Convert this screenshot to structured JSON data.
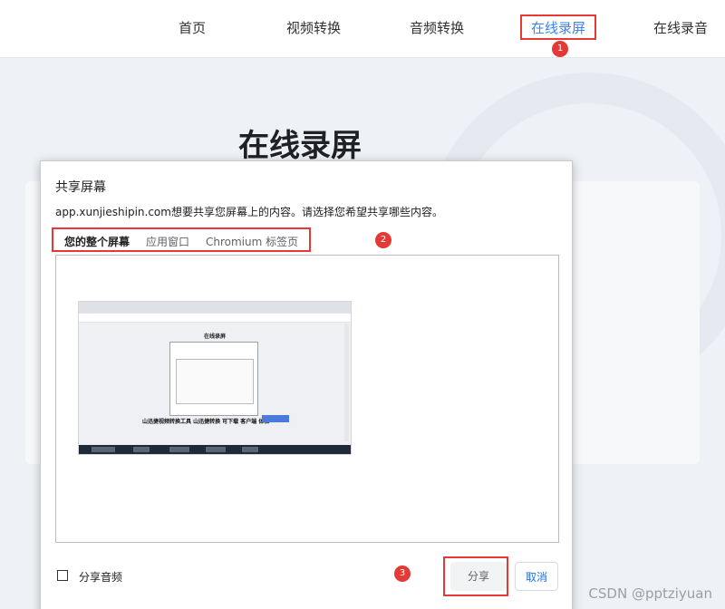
{
  "nav": {
    "items": [
      {
        "label": "首页"
      },
      {
        "label": "视频转换"
      },
      {
        "label": "音频转换"
      },
      {
        "label": "在线录屏",
        "active": true
      },
      {
        "label": "在线录音"
      }
    ]
  },
  "hero": {
    "title": "在线录屏"
  },
  "dialog": {
    "title": "共享屏幕",
    "description": "app.xunjieshipin.com想要共享您屏幕上的内容。请选择您希望共享哪些内容。",
    "tabs": [
      {
        "label": "您的整个屏幕",
        "active": true
      },
      {
        "label": "应用窗口"
      },
      {
        "label": "Chromium 标签页"
      }
    ],
    "thumbnail": {
      "page_title": "在线录屏",
      "bottom_text": "山迅捷视频转换工具 山迅捷转换 可下载 客户端 体验"
    },
    "share_audio_label": "分享音频",
    "share_button": "分享",
    "cancel_button": "取消"
  },
  "markers": [
    "1",
    "2",
    "3"
  ],
  "watermark": "CSDN @pptziyuan",
  "colors": {
    "accent": "#3b82f6",
    "marker": "#e53935"
  }
}
